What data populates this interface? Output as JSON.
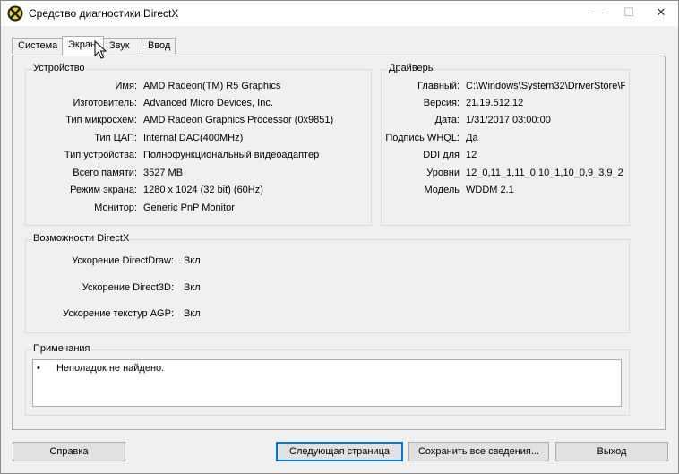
{
  "window": {
    "title": "Средство диагностики DirectX"
  },
  "titlebar_buttons": {
    "minimize": "—",
    "maximize": "☐",
    "close": "✕"
  },
  "tabs": [
    {
      "label": "Система"
    },
    {
      "label": "Экран"
    },
    {
      "label": "Звук"
    },
    {
      "label": "Ввод"
    }
  ],
  "device": {
    "title": "Устройство",
    "rows": [
      {
        "label": "Имя:",
        "value": "AMD Radeon(TM) R5 Graphics"
      },
      {
        "label": "Изготовитель:",
        "value": "Advanced Micro Devices, Inc."
      },
      {
        "label": "Тип микросхем:",
        "value": "AMD Radeon Graphics Processor (0x9851)"
      },
      {
        "label": "Тип ЦАП:",
        "value": "Internal DAC(400MHz)"
      },
      {
        "label": "Тип устройства:",
        "value": "Полнофункциональный видеоадаптер"
      },
      {
        "label": "Всего памяти:",
        "value": "3527 MB"
      },
      {
        "label": "Режим экрана:",
        "value": "1280 x 1024 (32 bit) (60Hz)"
      },
      {
        "label": "Монитор:",
        "value": "Generic PnP Monitor"
      }
    ]
  },
  "drivers": {
    "title": "Драйверы",
    "rows": [
      {
        "label": "Главный:",
        "value": "C:\\Windows\\System32\\DriverStore\\F"
      },
      {
        "label": "Версия:",
        "value": "21.19.512.12"
      },
      {
        "label": "Дата:",
        "value": "1/31/2017 03:00:00"
      },
      {
        "label": "Подпись WHQL:",
        "value": "Да"
      },
      {
        "label": "DDI для",
        "value": "12"
      },
      {
        "label": "Уровни",
        "value": "12_0,11_1,11_0,10_1,10_0,9_3,9_2"
      },
      {
        "label": "Модель",
        "value": "WDDM 2.1"
      }
    ]
  },
  "directx": {
    "title": "Возможности DirectX",
    "rows": [
      {
        "label": "Ускорение DirectDraw:",
        "value": "Вкл"
      },
      {
        "label": "Ускорение Direct3D:",
        "value": "Вкл"
      },
      {
        "label": "Ускорение текстур AGP:",
        "value": "Вкл"
      }
    ]
  },
  "notes": {
    "title": "Примечания",
    "bullet": "•",
    "items": [
      "Неполадок не найдено."
    ]
  },
  "buttons": {
    "help": "Справка",
    "next": "Следующая страница",
    "save": "Сохранить все сведения...",
    "exit": "Выход"
  },
  "colors": {
    "accent": "#0078d7",
    "window_bg": "#f0f0f0"
  },
  "icons": {
    "app": "directx-icon",
    "cursor": "mouse-pointer-icon"
  }
}
